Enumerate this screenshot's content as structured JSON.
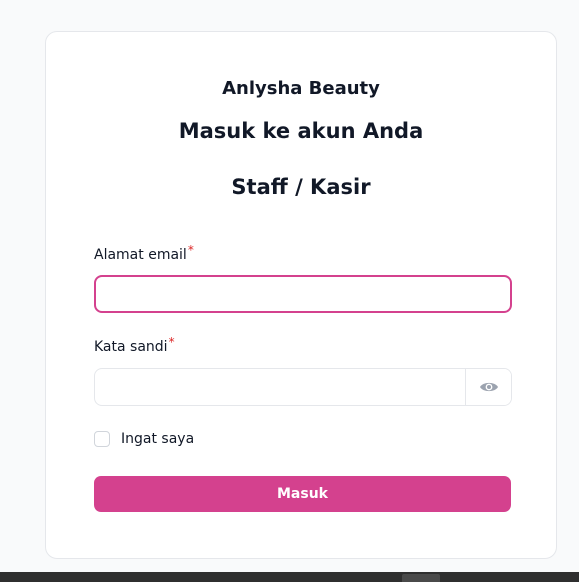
{
  "brand": "Anlysha Beauty",
  "heading": "Masuk ke akun Anda",
  "subheading": "Staff / Kasir",
  "form": {
    "email_label": "Alamat email",
    "email_value": "",
    "password_label": "Kata sandi",
    "password_value": "",
    "required_mark": "*",
    "remember_label": "Ingat saya",
    "submit_label": "Masuk"
  },
  "icons": {
    "password_toggle": "eye-icon"
  },
  "colors": {
    "accent": "#d4418e",
    "required": "#dc2626"
  }
}
